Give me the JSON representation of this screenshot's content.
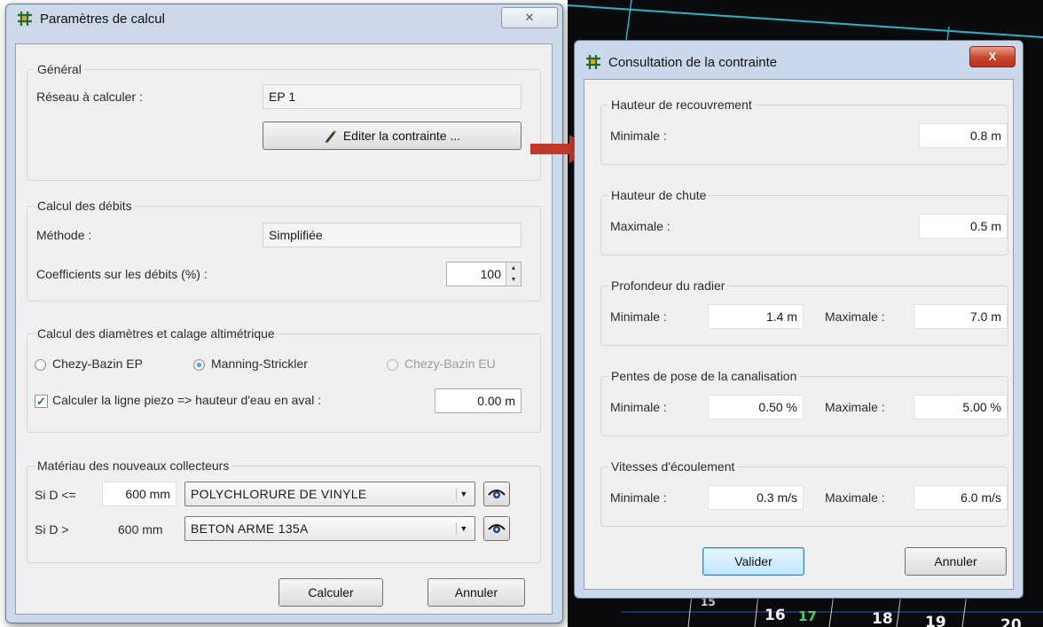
{
  "calc_window": {
    "title": "Paramètres de calcul",
    "close_glyph": "✕",
    "general": {
      "title": "Général",
      "network_label": "Réseau à calculer :",
      "network_value": "EP 1",
      "edit_button": "Editer la contrainte ..."
    },
    "flows": {
      "title": "Calcul des débits",
      "method_label": "Méthode :",
      "method_value": "Simplifiée",
      "coef_label": "Coefficients sur les débits (%) :",
      "coef_value": "100"
    },
    "diameters": {
      "title": "Calcul des diamètres et calage altimétrique",
      "radio_1": "Chezy-Bazin EP",
      "radio_2": "Manning-Strickler",
      "radio_3": "Chezy-Bazin EU",
      "selected_radio": "Manning-Strickler",
      "check_label": "Calculer la ligne piezo => hauteur d'eau en aval :",
      "check_checked": true,
      "check_mark": "✓",
      "check_value": "0.00 m"
    },
    "materials": {
      "title": "Matériau des nouveaux collecteurs",
      "row1_prefix": "Si D <=",
      "row1_value": "600 mm",
      "row1_material": "POLYCHLORURE DE VINYLE",
      "row2_prefix": "Si D >",
      "row2_value": "600 mm",
      "row2_material": "BETON ARME 135A"
    },
    "calculate_button": "Calculer",
    "cancel_button": "Annuler"
  },
  "constraint_window": {
    "title": "Consultation de la contrainte",
    "close_glyph": "X",
    "cover": {
      "title": "Hauteur de recouvrement",
      "min_label": "Minimale :",
      "min_value": "0.8 m"
    },
    "drop": {
      "title": "Hauteur de chute",
      "max_label": "Maximale :",
      "max_value": "0.5 m"
    },
    "depth": {
      "title": "Profondeur du radier",
      "min_label": "Minimale :",
      "min_value": "1.4 m",
      "max_label": "Maximale :",
      "max_value": "7.0 m"
    },
    "slopes": {
      "title": "Pentes de pose de la canalisation",
      "min_label": "Minimale :",
      "min_value": "0.50 %",
      "max_label": "Maximale :",
      "max_value": "5.00 %"
    },
    "speeds": {
      "title": "Vitesses d'écoulement",
      "min_label": "Minimale :",
      "min_value": "0.3 m/s",
      "max_label": "Maximale :",
      "max_value": "6.0 m/s"
    },
    "validate_button": "Valider",
    "cancel_button": "Annuler"
  },
  "cad_labels": [
    "15",
    "16",
    "17",
    "18",
    "19",
    "20"
  ],
  "colors": {
    "arrow": "#c0392b",
    "cad_line": "#2bb3c7",
    "background_cad": "#0b0b0d"
  },
  "icons": [
    "app-grid-icon",
    "pencil-icon",
    "eye-icon",
    "close-icon"
  ]
}
